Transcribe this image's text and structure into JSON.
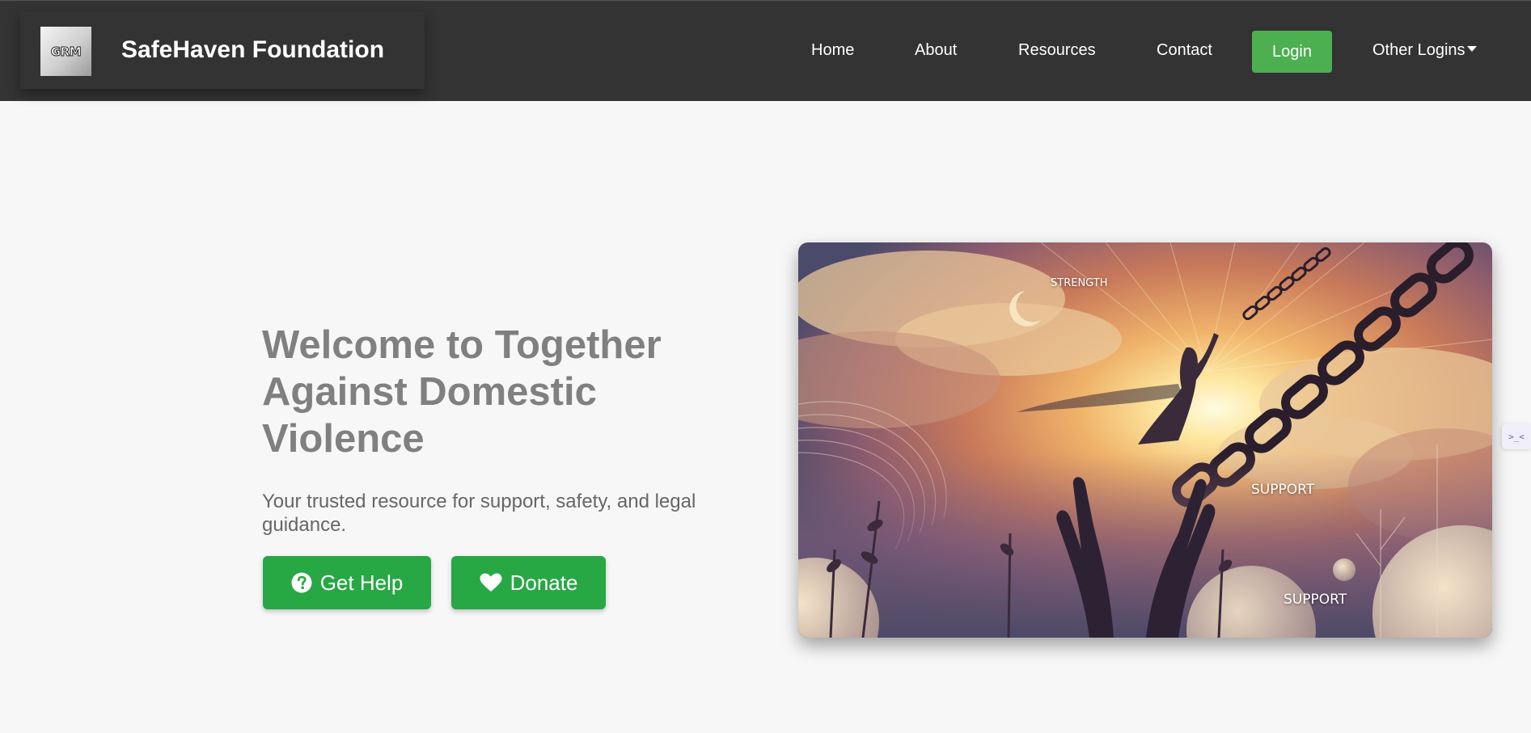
{
  "navbar": {
    "logo_text": "GRM",
    "brand_name": "SafeHaven Foundation",
    "links": {
      "home": "Home",
      "about": "About",
      "resources": "Resources",
      "contact": "Contact",
      "login": "Login",
      "other_logins": "Other Logins"
    }
  },
  "hero": {
    "title": "Welcome to Together Against Domestic Violence",
    "subtitle": "Your trusted resource for support, safety, and legal guidance.",
    "buttons": {
      "get_help": "Get Help",
      "donate": "Donate"
    },
    "image_words": {
      "strength": "STRENGTH",
      "support_1": "SUPPORT",
      "support_2": "SUPPORT"
    }
  },
  "side_widget": {
    "label": ">_<"
  },
  "colors": {
    "navbar_bg": "#333333",
    "login_green": "#4caf50",
    "button_green": "#28a745",
    "title_gray": "#808080",
    "page_bg": "#f7f7f7"
  },
  "icons": {
    "get_help": "question-circle-icon",
    "donate": "heart-icon",
    "dropdown": "caret-down-icon"
  }
}
